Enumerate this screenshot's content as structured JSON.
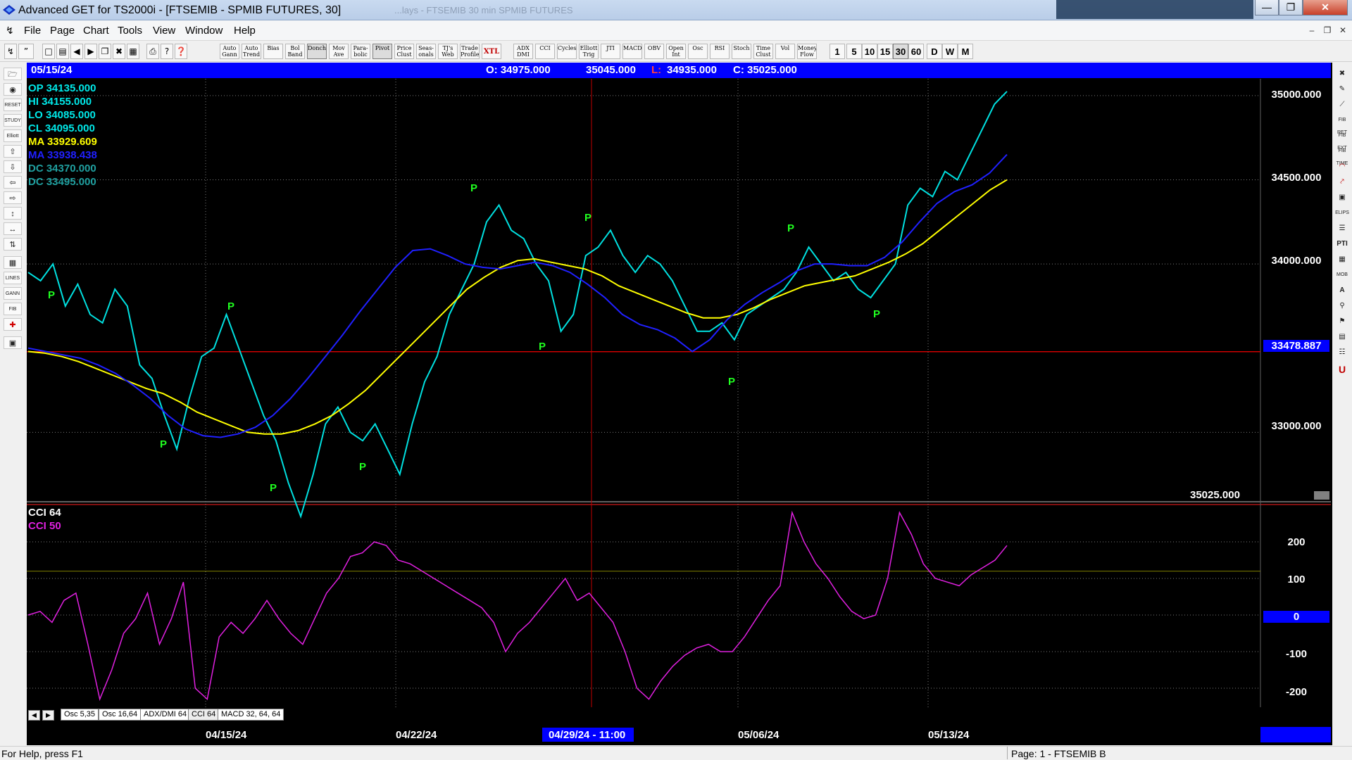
{
  "window": {
    "title": "Advanced GET for TS2000i - [FTSEMIB - SPMIB FUTURES, 30]",
    "ghost_title": "...lays - FTSEMIB   30 min   SPMIB FUTURES"
  },
  "menu": [
    "File",
    "Page",
    "Chart",
    "Tools",
    "View",
    "Window",
    "Help"
  ],
  "toolbar": {
    "study_buttons": [
      "Auto Gann",
      "Auto Trend",
      "Bias",
      "Bol Band",
      "Donch",
      "Mov Ave",
      "Para- bolic",
      "Pivot",
      "Price Clust",
      "Seas- onals",
      "TJ's Web",
      "Trade Profile",
      "XTL",
      "ADX DMI",
      "CCI",
      "Cycles",
      "Elliott Trig",
      "JTI",
      "MACD",
      "OBV",
      "Open Int",
      "Osc",
      "RSI",
      "Stoch",
      "Time Clust",
      "Vol",
      "Money Flow"
    ],
    "intervals": [
      "1",
      "5",
      "10",
      "15",
      "30",
      "60",
      "D",
      "W",
      "M"
    ],
    "selected_interval": "30"
  },
  "info_bar": {
    "date": "05/15/24",
    "open": "O: 34975.000",
    "high": "35045.000",
    "low_label": "L:",
    "low": "34935.000",
    "close": "C: 35025.000"
  },
  "legend": [
    {
      "text": "OP  34135.000",
      "color": "#00e8e8"
    },
    {
      "text": "HI   34155.000",
      "color": "#00e8e8"
    },
    {
      "text": "LO  34085.000",
      "color": "#00e8e8"
    },
    {
      "text": "CL  34095.000",
      "color": "#00e8e8"
    },
    {
      "text": "MA  33929.609",
      "color": "#ffff00"
    },
    {
      "text": "MA  33938.438",
      "color": "#2020ff"
    },
    {
      "text": "DC  34370.000",
      "color": "#20a0a0"
    },
    {
      "text": "DC  33495.000",
      "color": "#20a0a0"
    }
  ],
  "price_axis": {
    "labels": [
      "35000.000",
      "34500.000",
      "34000.000",
      "33000.000"
    ],
    "current": "33478.887",
    "last_price": "35025.000"
  },
  "cci_panel": {
    "label1": "CCI 64",
    "label2": "CCI  50",
    "axis_labels": [
      "200",
      "100",
      "0",
      "-100",
      "-200"
    ]
  },
  "tabs": [
    "Osc 5,35",
    "Osc 16,64",
    "ADX/DMI 64",
    "CCI 64",
    "MACD 32, 64, 64"
  ],
  "active_tab": "CCI 64",
  "dates": {
    "labels": [
      "04/15/24",
      "04/22/24",
      "05/06/24",
      "05/13/24"
    ],
    "cursor": "04/29/24 - 11:00"
  },
  "pivot_marker": "P",
  "status": {
    "help": "For Help, press F1",
    "page": "Page: 1 - FTSEMIB B"
  },
  "chart_data": [
    {
      "type": "line",
      "title": "FTSEMIB - SPMIB FUTURES, 30",
      "ylim": [
        32600,
        35100
      ],
      "series": [
        {
          "name": "CL",
          "values": [
            33950,
            33900,
            34000,
            33750,
            33880,
            33700,
            33650,
            33850,
            33750,
            33400,
            33320,
            33100,
            32900,
            33200,
            33450,
            33500,
            33700,
            33500,
            33300,
            33100,
            32950,
            32700,
            32500,
            32750,
            33050,
            33150,
            33000,
            32950,
            33050,
            32900,
            32750,
            33050,
            33300,
            33450,
            33700,
            33850,
            34000,
            34250,
            34350,
            34200,
            34150,
            34000,
            33900,
            33600,
            33700,
            34050,
            34100,
            34200,
            34050,
            33950,
            34050,
            34000,
            33900,
            33750,
            33600,
            33600,
            33650,
            33550,
            33700,
            33750,
            33800,
            33850,
            33950,
            34100,
            34000,
            33900,
            33950,
            33850,
            33800,
            33900,
            34000,
            34350,
            34450,
            34400,
            34550,
            34500,
            34650,
            34800,
            34950,
            35025
          ]
        },
        {
          "name": "MA",
          "values": [
            33480,
            33470,
            33450,
            33420,
            33380,
            33340,
            33300,
            33260,
            33230,
            33180,
            33120,
            33080,
            33040,
            33000,
            32990,
            32990,
            33010,
            33050,
            33100,
            33170,
            33250,
            33350,
            33450,
            33550,
            33650,
            33750,
            33850,
            33920,
            33980,
            34020,
            34030,
            34010,
            33990,
            33970,
            33930,
            33870,
            33830,
            33790,
            33750,
            33710,
            33680,
            33680,
            33700,
            33740,
            33790,
            33830,
            33870,
            33890,
            33910,
            33930,
            33970,
            34010,
            34060,
            34120,
            34200,
            34280,
            34360,
            34440,
            34500
          ]
        },
        {
          "name": "MA",
          "values": [
            33500,
            33480,
            33460,
            33440,
            33400,
            33350,
            33280,
            33200,
            33100,
            33020,
            32980,
            32970,
            32990,
            33030,
            33100,
            33200,
            33320,
            33450,
            33580,
            33720,
            33850,
            33980,
            34080,
            34090,
            34050,
            34000,
            33980,
            33970,
            33990,
            34010,
            33990,
            33950,
            33880,
            33800,
            33700,
            33640,
            33610,
            33560,
            33480,
            33550,
            33670,
            33760,
            33830,
            33890,
            33960,
            34000,
            34000,
            33990,
            33990,
            34040,
            34130,
            34250,
            34360,
            34430,
            34470,
            34540,
            34650
          ]
        }
      ]
    },
    {
      "type": "line",
      "title": "CCI 64",
      "ylim": [
        -250,
        300
      ],
      "series": [
        {
          "name": "CCI  50",
          "values": [
            0,
            10,
            -20,
            40,
            60,
            -80,
            -230,
            -150,
            -50,
            -10,
            60,
            -80,
            -10,
            90,
            -200,
            -230,
            -60,
            -20,
            -50,
            -10,
            40,
            -10,
            -50,
            -80,
            -10,
            60,
            100,
            160,
            170,
            200,
            190,
            150,
            140,
            120,
            100,
            80,
            60,
            40,
            20,
            -20,
            -100,
            -50,
            -20,
            20,
            60,
            100,
            40,
            60,
            20,
            -20,
            -100,
            -200,
            -230,
            -180,
            -140,
            -110,
            -90,
            -80,
            -100,
            -100,
            -60,
            -10,
            40,
            80,
            280,
            200,
            140,
            100,
            50,
            10,
            -10,
            0,
            100,
            280,
            220,
            140,
            100,
            90,
            80,
            110,
            130,
            150,
            190
          ]
        }
      ]
    }
  ]
}
